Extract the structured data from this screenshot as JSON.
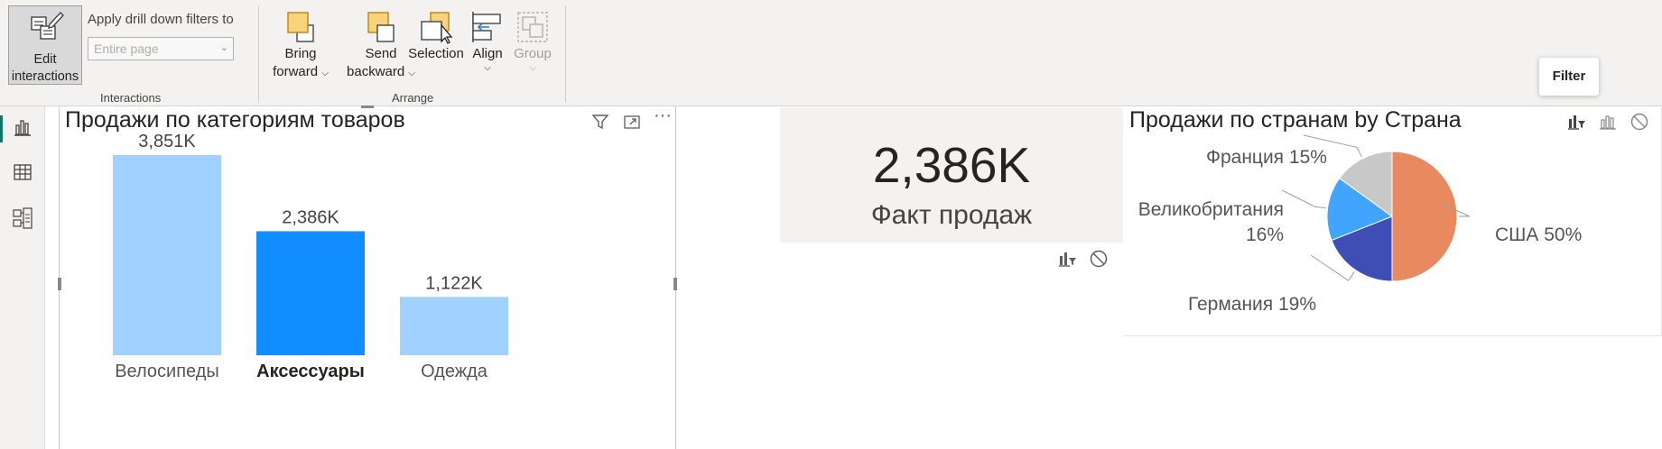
{
  "ribbon": {
    "edit_interactions": {
      "line1": "Edit",
      "line2": "interactions"
    },
    "drill_label": "Apply drill down filters to",
    "drill_select": {
      "value": "Entire page"
    },
    "group_interactions": "Interactions",
    "group_arrange": "Arrange",
    "bring_forward": {
      "line1": "Bring",
      "line2": "forward"
    },
    "send_backward": {
      "line1": "Send",
      "line2": "backward"
    },
    "selection": "Selection",
    "align": "Align",
    "group": "Group"
  },
  "rail": {
    "items": [
      "report-view",
      "data-view",
      "model-view"
    ]
  },
  "bar_visual": {
    "title": "Продажи по категориям товаров"
  },
  "card_visual": {
    "value": "2,386K",
    "label": "Факт продаж"
  },
  "pie_visual": {
    "title": "Продажи по странам by Страна",
    "tooltip": "Filter"
  },
  "colors": {
    "bar_light": "#a0d1ff",
    "bar_selected": "#118dff",
    "pie_usa": "#e8895f",
    "pie_germany": "#3f4eb4",
    "pie_uk": "#41a4ff",
    "pie_france": "#c8c8c8",
    "accent": "#117865"
  },
  "chart_data": [
    {
      "type": "bar",
      "title": "Продажи по категориям товаров",
      "categories": [
        "Велосипеды",
        "Аксессуары",
        "Одежда"
      ],
      "values": [
        3851,
        2386,
        1122
      ],
      "data_labels": [
        "3,851K",
        "2,386K",
        "1,122K"
      ],
      "selected": "Аксессуары",
      "ylim": [
        0,
        3851
      ]
    },
    {
      "type": "pie",
      "title": "Продажи по странам by Страна",
      "categories": [
        "США",
        "Германия",
        "Великобритания",
        "Франция"
      ],
      "values": [
        50,
        19,
        16,
        15
      ],
      "data_labels": [
        "США 50%",
        "Германия 19%",
        "Великобритания 16%",
        "Франция 15%"
      ]
    }
  ]
}
